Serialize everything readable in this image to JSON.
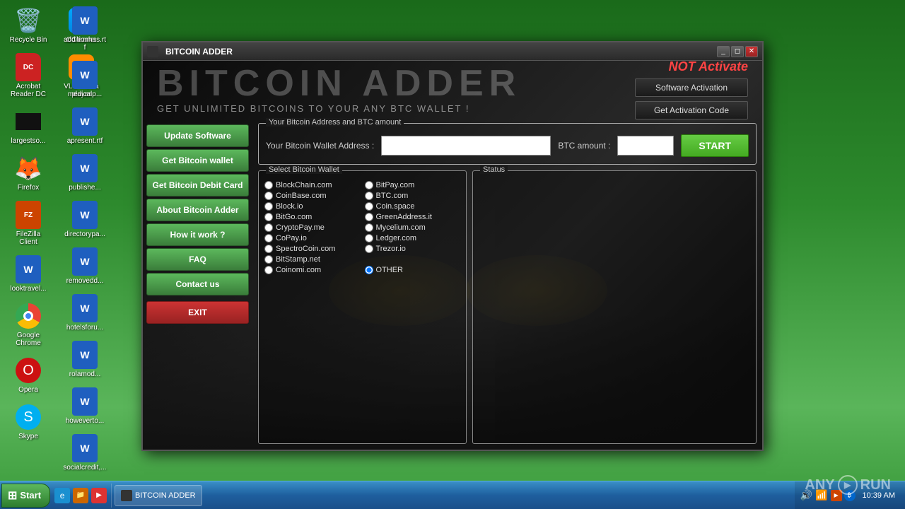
{
  "desktop": {
    "background_color": "#2d6a2d"
  },
  "taskbar": {
    "start_label": "Start",
    "clock": "10:39 AM",
    "items": [
      {
        "label": "BITCOIN ADDER",
        "icon": "bitcoin-icon"
      }
    ]
  },
  "desktop_icons_col1": [
    {
      "id": "recycle-bin",
      "label": "Recycle Bin",
      "icon": "🗑️"
    },
    {
      "id": "acrobat",
      "label": "Acrobat Reader DC",
      "icon": "PDF"
    },
    {
      "id": "black-box",
      "label": "largestso...",
      "icon": "■"
    },
    {
      "id": "firefox",
      "label": "Firefox",
      "icon": "🦊"
    },
    {
      "id": "filezilla",
      "label": "FileZilla Client",
      "icon": "FZ"
    },
    {
      "id": "looktravel",
      "label": "looktravel...",
      "icon": "W"
    },
    {
      "id": "chrome",
      "label": "Google Chrome",
      "icon": "chrome"
    },
    {
      "id": "opera",
      "label": "Opera",
      "icon": "O"
    },
    {
      "id": "skype",
      "label": "Skype",
      "icon": "S"
    },
    {
      "id": "ccleaner",
      "label": "CCleaner",
      "icon": "CC"
    },
    {
      "id": "vlc",
      "label": "VLC media player",
      "icon": "▶"
    }
  ],
  "desktop_icons_col2": [
    {
      "id": "additionhas",
      "label": "additionhas.rtf",
      "icon": "W"
    },
    {
      "id": "medicalp",
      "label": "medicalp...",
      "icon": "W"
    },
    {
      "id": "apresent",
      "label": "apresent.rtf",
      "icon": "W"
    },
    {
      "id": "publishe",
      "label": "publishe...",
      "icon": "W"
    },
    {
      "id": "directorypa",
      "label": "directorypa...",
      "icon": "W"
    },
    {
      "id": "removedd",
      "label": "removedd...",
      "icon": "W"
    },
    {
      "id": "hotelsforu",
      "label": "hotelsforu...",
      "icon": "W"
    },
    {
      "id": "rolamod",
      "label": "rolamod...",
      "icon": "W"
    },
    {
      "id": "howeverto",
      "label": "howeverto...",
      "icon": "W"
    },
    {
      "id": "socialcredit",
      "label": "socialcredit,...",
      "icon": "W"
    }
  ],
  "window": {
    "title": "BITCOIN ADDER",
    "controls": [
      "minimize",
      "restore",
      "close"
    ]
  },
  "app": {
    "title": "BITCOIN ADDER",
    "subtitle": "GET UNLIMITED BITCOINS TO YOUR ANY BTC WALLET !",
    "not_activate": "NOT Activate",
    "software_activation_btn": "Software Activation",
    "get_activation_code_btn": "Get Activation Code",
    "address_section_title": "Your Bitcoin Address and BTC amount",
    "wallet_address_label": "Your Bitcoin Wallet Address :",
    "wallet_address_placeholder": "",
    "btc_amount_label": "BTC amount :",
    "btc_amount_placeholder": "",
    "start_btn": "START",
    "sidebar_buttons": [
      {
        "id": "update-software",
        "label": "Update Software"
      },
      {
        "id": "get-bitcoin-wallet",
        "label": "Get Bitcoin wallet"
      },
      {
        "id": "get-bitcoin-debit",
        "label": "Get Bitcoin Debit Card"
      },
      {
        "id": "about-bitcoin-adder",
        "label": "About Bitcoin Adder"
      },
      {
        "id": "how-it-work",
        "label": "How it work ?"
      },
      {
        "id": "faq",
        "label": "FAQ"
      },
      {
        "id": "contact-us",
        "label": "Contact us"
      },
      {
        "id": "exit",
        "label": "EXIT",
        "style": "exit"
      }
    ],
    "wallet_section_title": "Select Bitcoin Wallet",
    "wallet_options": [
      {
        "id": "blockchain",
        "label": "BlockChain.com",
        "col": 1,
        "checked": false
      },
      {
        "id": "bitpay",
        "label": "BitPay.com",
        "col": 2,
        "checked": false
      },
      {
        "id": "coinbase",
        "label": "CoinBase.com",
        "col": 1,
        "checked": false
      },
      {
        "id": "btccom",
        "label": "BTC.com",
        "col": 2,
        "checked": false
      },
      {
        "id": "blockio",
        "label": "Block.io",
        "col": 1,
        "checked": false
      },
      {
        "id": "coinspace",
        "label": "Coin.space",
        "col": 2,
        "checked": false
      },
      {
        "id": "bitgocom",
        "label": "BitGo.com",
        "col": 1,
        "checked": false
      },
      {
        "id": "greenaddress",
        "label": "GreenAddress.it",
        "col": 2,
        "checked": false
      },
      {
        "id": "cryptopay",
        "label": "CryptoPay.me",
        "col": 1,
        "checked": false
      },
      {
        "id": "mycelium",
        "label": "Mycelium.com",
        "col": 2,
        "checked": false
      },
      {
        "id": "copay",
        "label": "CoPay.io",
        "col": 1,
        "checked": false
      },
      {
        "id": "ledger",
        "label": "Ledger.com",
        "col": 2,
        "checked": false
      },
      {
        "id": "spectrocoin",
        "label": "SpectroCoin.com",
        "col": 1,
        "checked": false
      },
      {
        "id": "trezor",
        "label": "Trezor.io",
        "col": 2,
        "checked": false
      },
      {
        "id": "bitstamp",
        "label": "BitStamp.net",
        "col": 1,
        "checked": false
      },
      {
        "id": "coinomi",
        "label": "Coinomi.com",
        "col": 1,
        "checked": false
      },
      {
        "id": "other",
        "label": "OTHER",
        "col": 2,
        "checked": true
      }
    ],
    "status_section_title": "Status"
  },
  "anyrun": {
    "text": "ANY  RUN"
  }
}
